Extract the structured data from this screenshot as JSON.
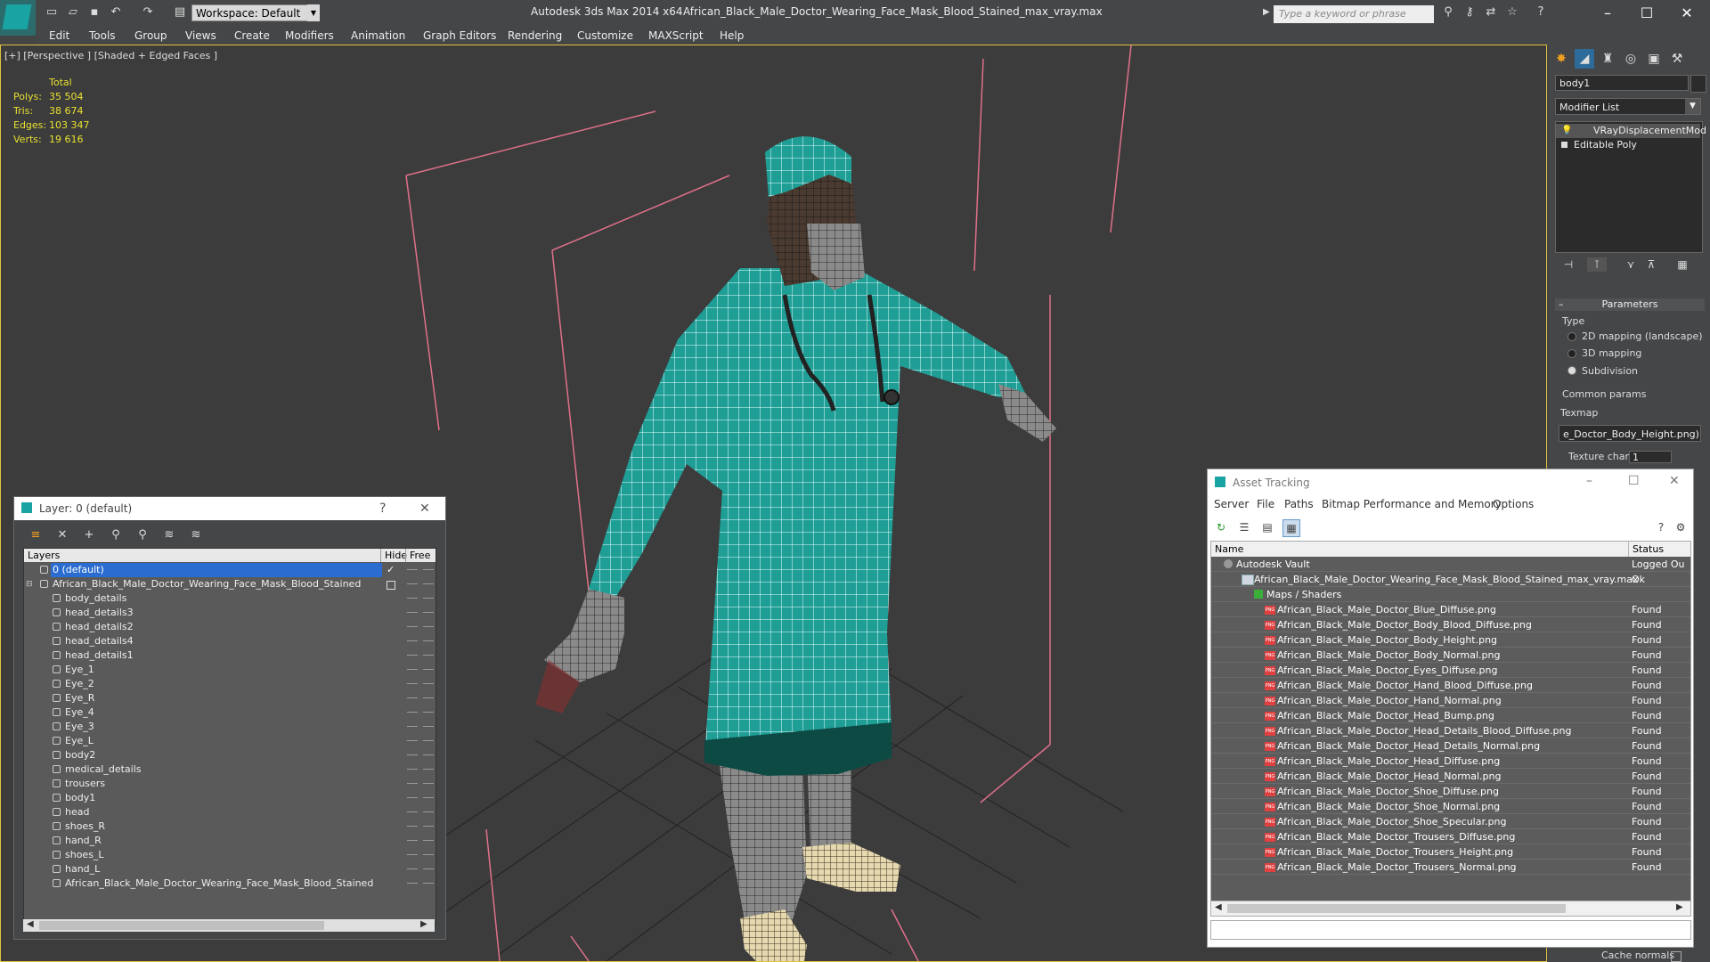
{
  "titlebar": {
    "workspace": "Workspace: Default",
    "app_title": "Autodesk 3ds Max  2014 x64",
    "file_title": "African_Black_Male_Doctor_Wearing_Face_Mask_Blood_Stained_max_vray.max",
    "search_placeholder": "Type a keyword or phrase"
  },
  "menu": [
    "Edit",
    "Tools",
    "Group",
    "Views",
    "Create",
    "Modifiers",
    "Animation",
    "Graph Editors",
    "Rendering",
    "Customize",
    "MAXScript",
    "Help"
  ],
  "viewport": {
    "label": "[+] [Perspective ] [Shaded + Edged Faces ]",
    "stats_header": "Total",
    "stats": [
      {
        "label": "Polys:",
        "value": "35 504"
      },
      {
        "label": "Tris:",
        "value": "38 674"
      },
      {
        "label": "Edges:",
        "value": "103 347"
      },
      {
        "label": "Verts:",
        "value": "19 616"
      }
    ]
  },
  "command_panel": {
    "object_name": "body1",
    "modifier_list": "Modifier List",
    "stack": [
      "VRayDisplacementMod",
      "Editable Poly"
    ],
    "parameters_title": "Parameters",
    "type_label": "Type",
    "type_options": [
      "2D mapping (landscape)",
      "3D mapping",
      "Subdivision"
    ],
    "type_selected": 2,
    "common_params": "Common params",
    "texmap_label": "Texmap",
    "texmap_value": "e_Doctor_Body_Height.png)",
    "texture_chan_label": "Texture chan",
    "texture_chan_value": "1",
    "cache_normals": "Cache normals"
  },
  "layer_dialog": {
    "title": "Layer: 0 (default)",
    "help": "?",
    "close": "✕",
    "columns": {
      "layers": "Layers",
      "hide": "Hide",
      "freeze": "Free"
    },
    "rows": [
      {
        "name": "0 (default)",
        "level": 0,
        "selected": true
      },
      {
        "name": "African_Black_Male_Doctor_Wearing_Face_Mask_Blood_Stained",
        "level": 0
      },
      {
        "name": "body_details",
        "level": 1
      },
      {
        "name": "head_details3",
        "level": 1
      },
      {
        "name": "head_details2",
        "level": 1
      },
      {
        "name": "head_details4",
        "level": 1
      },
      {
        "name": "head_details1",
        "level": 1
      },
      {
        "name": "Eye_1",
        "level": 1
      },
      {
        "name": "Eye_2",
        "level": 1
      },
      {
        "name": "Eye_R",
        "level": 1
      },
      {
        "name": "Eye_4",
        "level": 1
      },
      {
        "name": "Eye_3",
        "level": 1
      },
      {
        "name": "Eye_L",
        "level": 1
      },
      {
        "name": "body2",
        "level": 1
      },
      {
        "name": "medical_details",
        "level": 1
      },
      {
        "name": "trousers",
        "level": 1
      },
      {
        "name": "body1",
        "level": 1
      },
      {
        "name": "head",
        "level": 1
      },
      {
        "name": "shoes_R",
        "level": 1
      },
      {
        "name": "hand_R",
        "level": 1
      },
      {
        "name": "shoes_L",
        "level": 1
      },
      {
        "name": "hand_L",
        "level": 1
      },
      {
        "name": "African_Black_Male_Doctor_Wearing_Face_Mask_Blood_Stained",
        "level": 1
      }
    ]
  },
  "asset_tracking": {
    "title": "Asset Tracking",
    "menu": [
      "Server",
      "File",
      "Paths",
      "Bitmap Performance and Memory",
      "Options"
    ],
    "columns": {
      "name": "Name",
      "status": "Status"
    },
    "rows": [
      {
        "name": "Autodesk Vault",
        "status": "Logged Ou",
        "level": 0
      },
      {
        "name": "African_Black_Male_Doctor_Wearing_Face_Mask_Blood_Stained_max_vray.max",
        "status": "Ok",
        "level": 1
      },
      {
        "name": "Maps / Shaders",
        "status": "",
        "level": 2
      },
      {
        "name": "African_Black_Male_Doctor_Blue_Diffuse.png",
        "status": "Found",
        "level": 3
      },
      {
        "name": "African_Black_Male_Doctor_Body_Blood_Diffuse.png",
        "status": "Found",
        "level": 3
      },
      {
        "name": "African_Black_Male_Doctor_Body_Height.png",
        "status": "Found",
        "level": 3
      },
      {
        "name": "African_Black_Male_Doctor_Body_Normal.png",
        "status": "Found",
        "level": 3
      },
      {
        "name": "African_Black_Male_Doctor_Eyes_Diffuse.png",
        "status": "Found",
        "level": 3
      },
      {
        "name": "African_Black_Male_Doctor_Hand_Blood_Diffuse.png",
        "status": "Found",
        "level": 3
      },
      {
        "name": "African_Black_Male_Doctor_Hand_Normal.png",
        "status": "Found",
        "level": 3
      },
      {
        "name": "African_Black_Male_Doctor_Head_Bump.png",
        "status": "Found",
        "level": 3
      },
      {
        "name": "African_Black_Male_Doctor_Head_Details_Blood_Diffuse.png",
        "status": "Found",
        "level": 3
      },
      {
        "name": "African_Black_Male_Doctor_Head_Details_Normal.png",
        "status": "Found",
        "level": 3
      },
      {
        "name": "African_Black_Male_Doctor_Head_Diffuse.png",
        "status": "Found",
        "level": 3
      },
      {
        "name": "African_Black_Male_Doctor_Head_Normal.png",
        "status": "Found",
        "level": 3
      },
      {
        "name": "African_Black_Male_Doctor_Shoe_Diffuse.png",
        "status": "Found",
        "level": 3
      },
      {
        "name": "African_Black_Male_Doctor_Shoe_Normal.png",
        "status": "Found",
        "level": 3
      },
      {
        "name": "African_Black_Male_Doctor_Shoe_Specular.png",
        "status": "Found",
        "level": 3
      },
      {
        "name": "African_Black_Male_Doctor_Trousers_Diffuse.png",
        "status": "Found",
        "level": 3
      },
      {
        "name": "African_Black_Male_Doctor_Trousers_Height.png",
        "status": "Found",
        "level": 3
      },
      {
        "name": "African_Black_Male_Doctor_Trousers_Normal.png",
        "status": "Found",
        "level": 3
      }
    ]
  },
  "colors": {
    "accent": "#1aa3a3",
    "selection": "#2a6ccf",
    "stats": "#e8e030",
    "viewport_border": "#e0c040",
    "scrubs": "#1f9e96"
  }
}
